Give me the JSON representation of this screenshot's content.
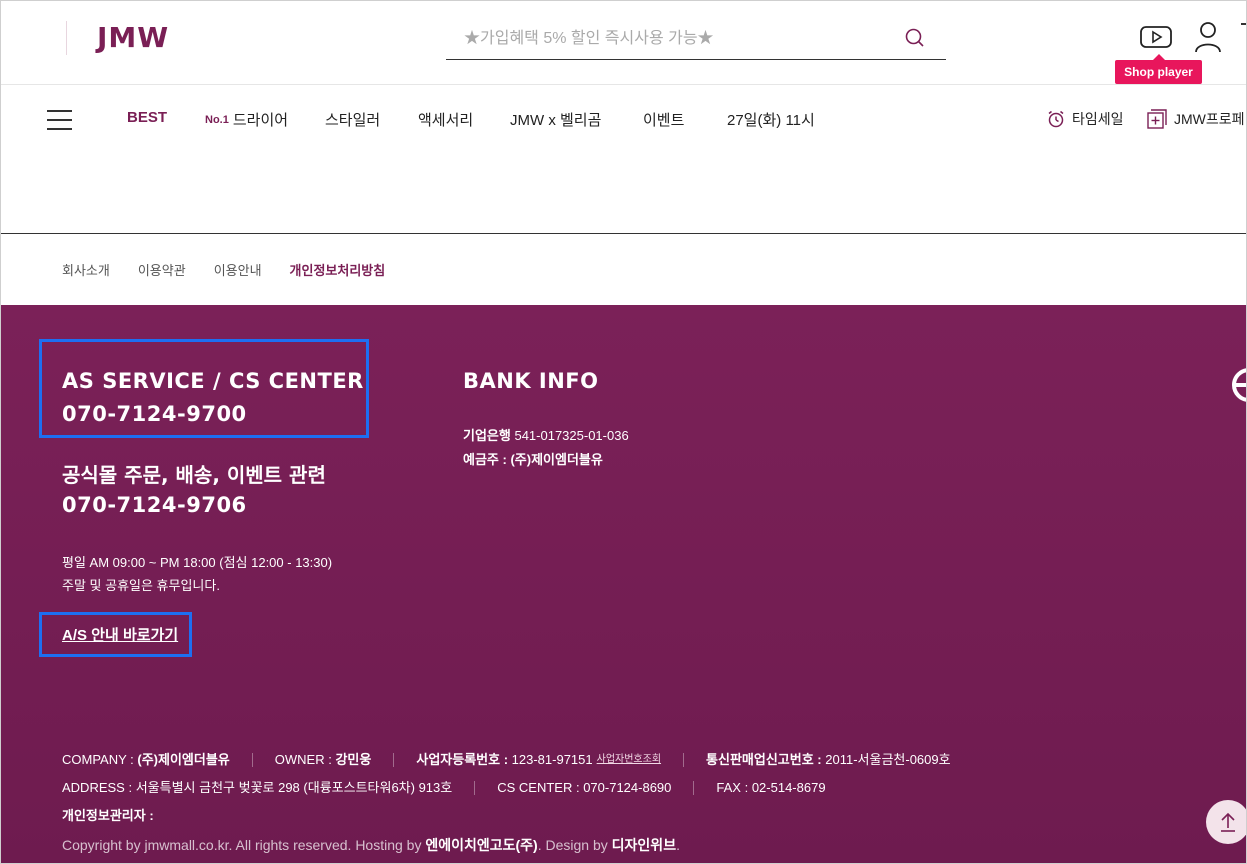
{
  "header": {
    "logo": "JMW",
    "search_placeholder": "★가입혜택 5% 할인 즉시사용 가능★",
    "shop_player_label": "Shop player",
    "icons": [
      "search-icon",
      "youtube-play-icon",
      "user-icon"
    ]
  },
  "nav": {
    "items": [
      {
        "label": "BEST"
      },
      {
        "prefix": "No.1",
        "label": "드라이어"
      },
      {
        "label": "스타일러"
      },
      {
        "label": "액세서리"
      },
      {
        "label": "JMW x 벨리곰"
      },
      {
        "label": "이벤트"
      },
      {
        "label": "27일(화) 11시"
      }
    ],
    "right": [
      {
        "label": "타임세일",
        "icon": "alarm-clock-icon"
      },
      {
        "label": "JMW프로페",
        "icon": "plus-square-icon"
      }
    ]
  },
  "footer_links": [
    "회사소개",
    "이용약관",
    "이용안내",
    "개인정보처리방침"
  ],
  "footer": {
    "cs_title": "AS SERVICE / CS CENTER",
    "cs_phone": "070-7124-9700",
    "order_title": "공식몰 주문, 배송, 이벤트 관련",
    "order_phone": "070-7124-9706",
    "hours_line1": "평일 AM 09:00 ~ PM 18:00 (점심 12:00 - 13:30)",
    "hours_line2": "주말 및 공휴일은 휴무입니다.",
    "as_link": "A/S 안내 바로가기",
    "bank_title": "BANK INFO",
    "bank_name": "기업은행",
    "bank_account": "541-017325-01-036",
    "bank_holder_label": "예금주 :",
    "bank_holder": "(주)제이엠더블유",
    "company_label": "COMPANY :",
    "company": "(주)제이엠더블유",
    "owner_label": "OWNER :",
    "owner": "강민웅",
    "biz_label": "사업자등록번호 :",
    "biz_no": "123-81-97151",
    "biz_link": "사업자번호조회",
    "mail_label": "통신판매업신고번호 :",
    "mail_no": "2011-서울금천-0609호",
    "address_label": "ADDRESS :",
    "address": "서울특별시 금천구 벚꽃로 298 (대륭포스트타워6차) 913호",
    "cs_center_label": "CS CENTER :",
    "cs_center": "070-7124-8690",
    "fax_label": "FAX :",
    "fax": "02-514-8679",
    "privacy_label": "개인정보관리자 :",
    "copyright_pre": "Copyright by jmwmall.co.kr. All rights reserved. Hosting by",
    "hosting": "엔에이치엔고도(주)",
    "design_pre": ". Design by",
    "designer": "디자인위브",
    "copyright_end": "."
  },
  "colors": {
    "brand": "#7a1f55",
    "footer_bg": "#7b2158",
    "tooltip": "#e8165c",
    "highlight_box": "#1d6ff2"
  }
}
